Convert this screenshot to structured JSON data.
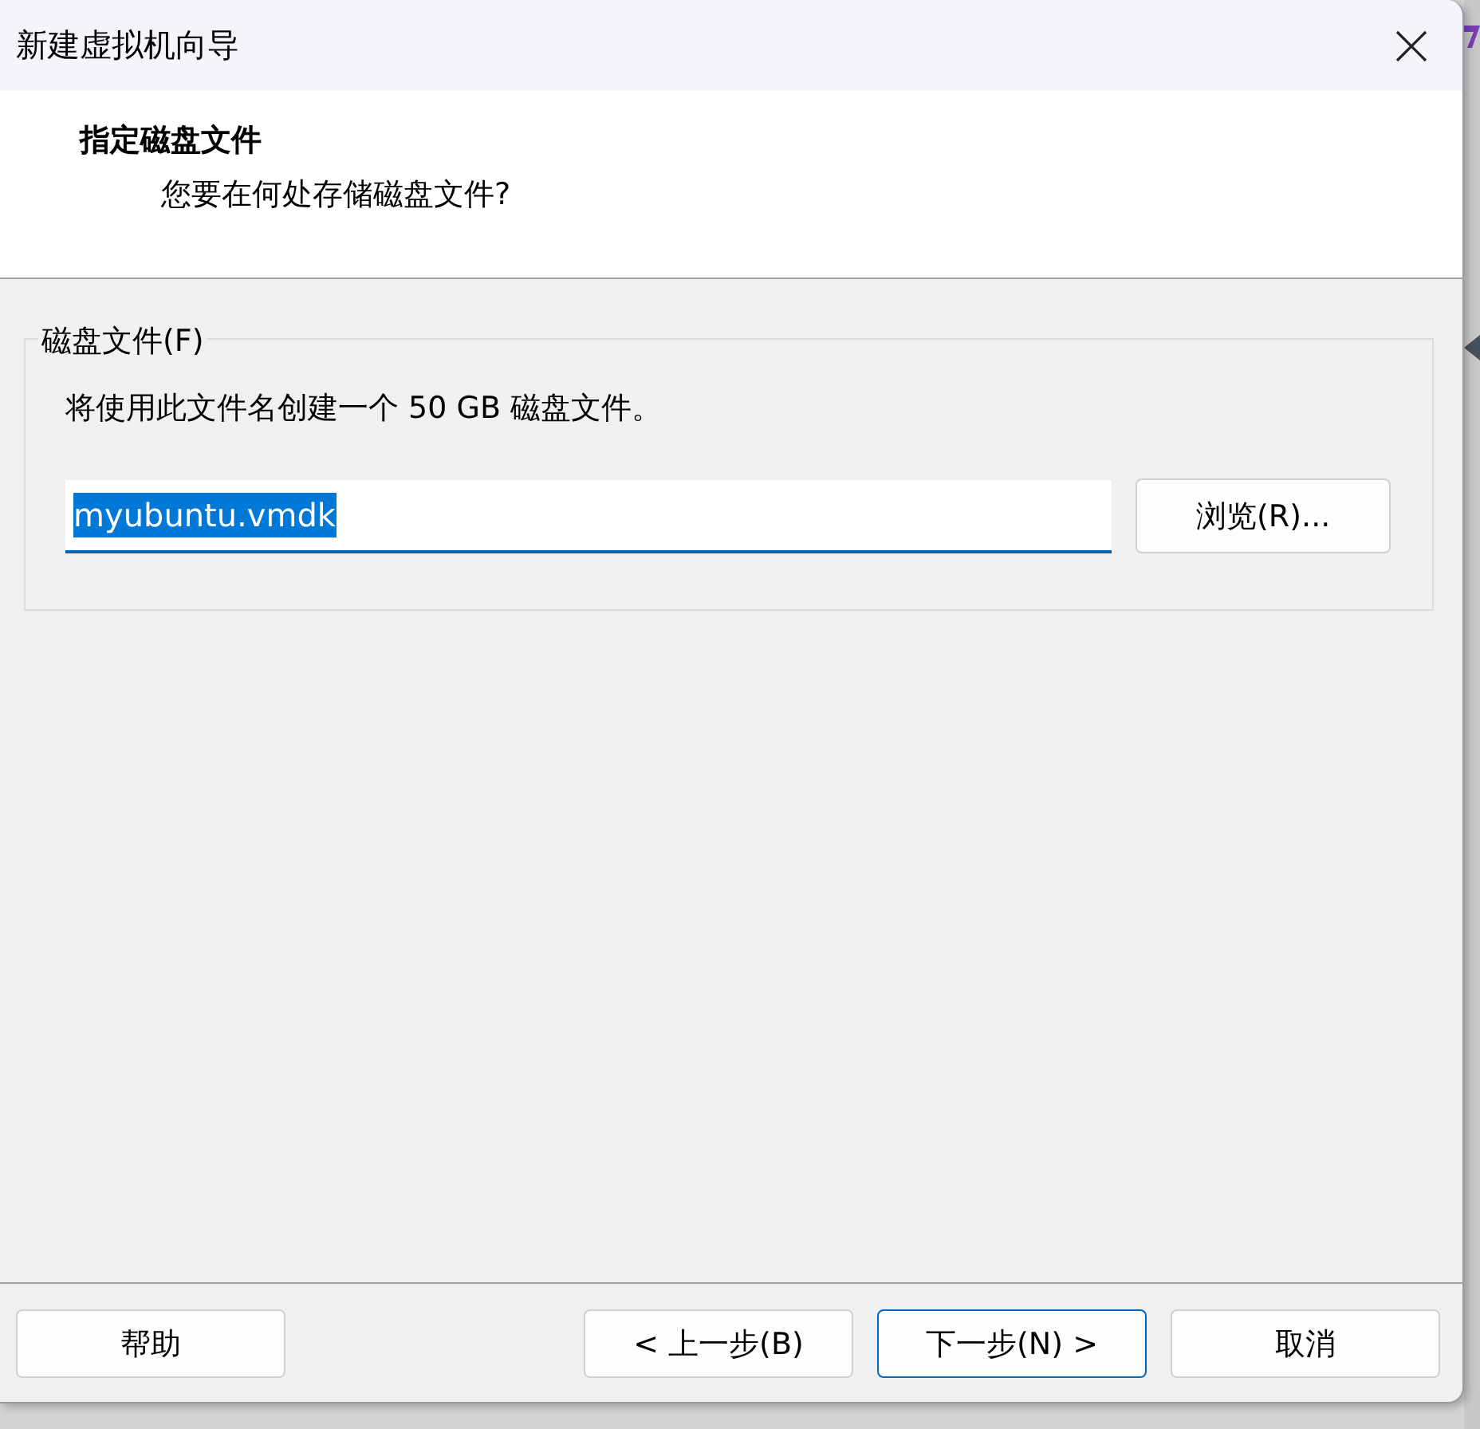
{
  "window": {
    "title": "新建虚拟机向导"
  },
  "header": {
    "title": "指定磁盘文件",
    "subtitle": "您要在何处存储磁盘文件?"
  },
  "group": {
    "legend": "磁盘文件(F)",
    "description": "将使用此文件名创建一个 50 GB 磁盘文件。",
    "field": {
      "value": "myubuntu.vmdk",
      "selected": true
    },
    "browse_button": "浏览(R)..."
  },
  "buttons": [
    {
      "label": "帮助",
      "default": false
    },
    {
      "label": "< 上一步(B)",
      "default": false
    },
    {
      "label": "下一步(N) >",
      "default": true
    },
    {
      "label": "取消",
      "default": false
    }
  ]
}
